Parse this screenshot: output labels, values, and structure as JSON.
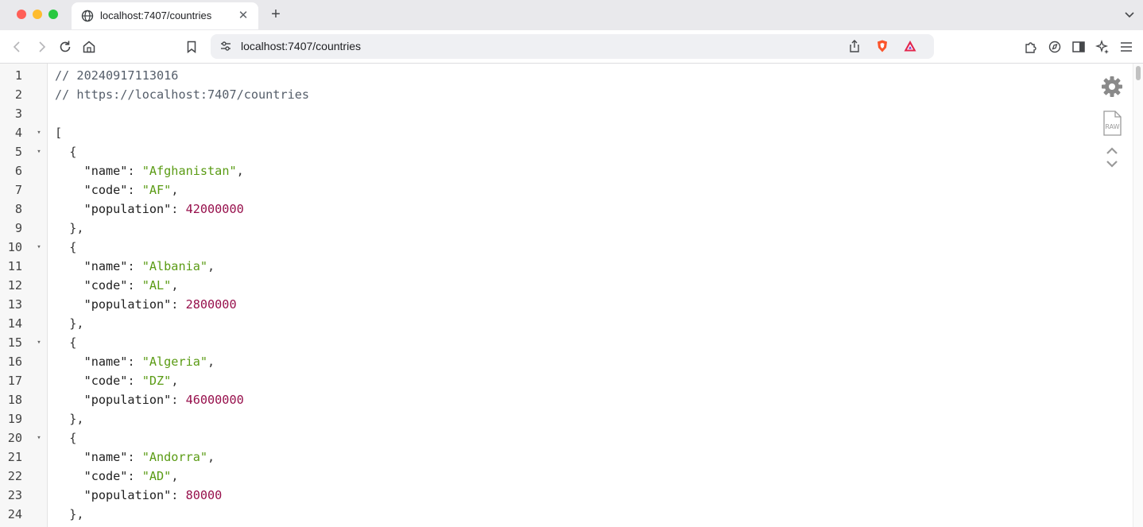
{
  "browser": {
    "tab": {
      "title": "localhost:7407/countries",
      "icon": "globe-icon"
    },
    "address_bar": {
      "url": "localhost:7407/countries"
    }
  },
  "viewer": {
    "lines": [
      {
        "n": "1",
        "fold": false,
        "indent": 0,
        "tokens": [
          {
            "t": "// 20240917113016",
            "c": "cmt"
          }
        ]
      },
      {
        "n": "2",
        "fold": false,
        "indent": 0,
        "tokens": [
          {
            "t": "// https://localhost:7407/countries",
            "c": "cmt"
          }
        ]
      },
      {
        "n": "3",
        "fold": false,
        "indent": 0,
        "tokens": []
      },
      {
        "n": "4",
        "fold": true,
        "indent": 0,
        "tokens": [
          {
            "t": "[",
            "c": "punc"
          }
        ]
      },
      {
        "n": "5",
        "fold": true,
        "indent": 1,
        "tokens": [
          {
            "t": "{",
            "c": "punc"
          }
        ]
      },
      {
        "n": "6",
        "fold": false,
        "indent": 2,
        "tokens": [
          {
            "t": "\"name\"",
            "c": "key"
          },
          {
            "t": ": ",
            "c": "punc"
          },
          {
            "t": "\"Afghanistan\"",
            "c": "str"
          },
          {
            "t": ",",
            "c": "punc"
          }
        ]
      },
      {
        "n": "7",
        "fold": false,
        "indent": 2,
        "tokens": [
          {
            "t": "\"code\"",
            "c": "key"
          },
          {
            "t": ": ",
            "c": "punc"
          },
          {
            "t": "\"AF\"",
            "c": "str"
          },
          {
            "t": ",",
            "c": "punc"
          }
        ]
      },
      {
        "n": "8",
        "fold": false,
        "indent": 2,
        "tokens": [
          {
            "t": "\"population\"",
            "c": "key"
          },
          {
            "t": ": ",
            "c": "punc"
          },
          {
            "t": "42000000",
            "c": "num"
          }
        ]
      },
      {
        "n": "9",
        "fold": false,
        "indent": 1,
        "tokens": [
          {
            "t": "},",
            "c": "punc"
          }
        ]
      },
      {
        "n": "10",
        "fold": true,
        "indent": 1,
        "tokens": [
          {
            "t": "{",
            "c": "punc"
          }
        ]
      },
      {
        "n": "11",
        "fold": false,
        "indent": 2,
        "tokens": [
          {
            "t": "\"name\"",
            "c": "key"
          },
          {
            "t": ": ",
            "c": "punc"
          },
          {
            "t": "\"Albania\"",
            "c": "str"
          },
          {
            "t": ",",
            "c": "punc"
          }
        ]
      },
      {
        "n": "12",
        "fold": false,
        "indent": 2,
        "tokens": [
          {
            "t": "\"code\"",
            "c": "key"
          },
          {
            "t": ": ",
            "c": "punc"
          },
          {
            "t": "\"AL\"",
            "c": "str"
          },
          {
            "t": ",",
            "c": "punc"
          }
        ]
      },
      {
        "n": "13",
        "fold": false,
        "indent": 2,
        "tokens": [
          {
            "t": "\"population\"",
            "c": "key"
          },
          {
            "t": ": ",
            "c": "punc"
          },
          {
            "t": "2800000",
            "c": "num"
          }
        ]
      },
      {
        "n": "14",
        "fold": false,
        "indent": 1,
        "tokens": [
          {
            "t": "},",
            "c": "punc"
          }
        ]
      },
      {
        "n": "15",
        "fold": true,
        "indent": 1,
        "tokens": [
          {
            "t": "{",
            "c": "punc"
          }
        ]
      },
      {
        "n": "16",
        "fold": false,
        "indent": 2,
        "tokens": [
          {
            "t": "\"name\"",
            "c": "key"
          },
          {
            "t": ": ",
            "c": "punc"
          },
          {
            "t": "\"Algeria\"",
            "c": "str"
          },
          {
            "t": ",",
            "c": "punc"
          }
        ]
      },
      {
        "n": "17",
        "fold": false,
        "indent": 2,
        "tokens": [
          {
            "t": "\"code\"",
            "c": "key"
          },
          {
            "t": ": ",
            "c": "punc"
          },
          {
            "t": "\"DZ\"",
            "c": "str"
          },
          {
            "t": ",",
            "c": "punc"
          }
        ]
      },
      {
        "n": "18",
        "fold": false,
        "indent": 2,
        "tokens": [
          {
            "t": "\"population\"",
            "c": "key"
          },
          {
            "t": ": ",
            "c": "punc"
          },
          {
            "t": "46000000",
            "c": "num"
          }
        ]
      },
      {
        "n": "19",
        "fold": false,
        "indent": 1,
        "tokens": [
          {
            "t": "},",
            "c": "punc"
          }
        ]
      },
      {
        "n": "20",
        "fold": true,
        "indent": 1,
        "tokens": [
          {
            "t": "{",
            "c": "punc"
          }
        ]
      },
      {
        "n": "21",
        "fold": false,
        "indent": 2,
        "tokens": [
          {
            "t": "\"name\"",
            "c": "key"
          },
          {
            "t": ": ",
            "c": "punc"
          },
          {
            "t": "\"Andorra\"",
            "c": "str"
          },
          {
            "t": ",",
            "c": "punc"
          }
        ]
      },
      {
        "n": "22",
        "fold": false,
        "indent": 2,
        "tokens": [
          {
            "t": "\"code\"",
            "c": "key"
          },
          {
            "t": ": ",
            "c": "punc"
          },
          {
            "t": "\"AD\"",
            "c": "str"
          },
          {
            "t": ",",
            "c": "punc"
          }
        ]
      },
      {
        "n": "23",
        "fold": false,
        "indent": 2,
        "tokens": [
          {
            "t": "\"population\"",
            "c": "key"
          },
          {
            "t": ": ",
            "c": "punc"
          },
          {
            "t": "80000",
            "c": "num"
          }
        ]
      },
      {
        "n": "24",
        "fold": false,
        "indent": 1,
        "tokens": [
          {
            "t": "},",
            "c": "punc"
          }
        ]
      }
    ],
    "fold_glyph": "▾",
    "side_icons": [
      "gear-icon",
      "raw-icon",
      "chevron-up-icon",
      "chevron-down-icon"
    ]
  },
  "colors": {
    "comment": "#555e6a",
    "string": "#5a9b14",
    "number": "#97104c",
    "key": "#1f1f1f"
  }
}
